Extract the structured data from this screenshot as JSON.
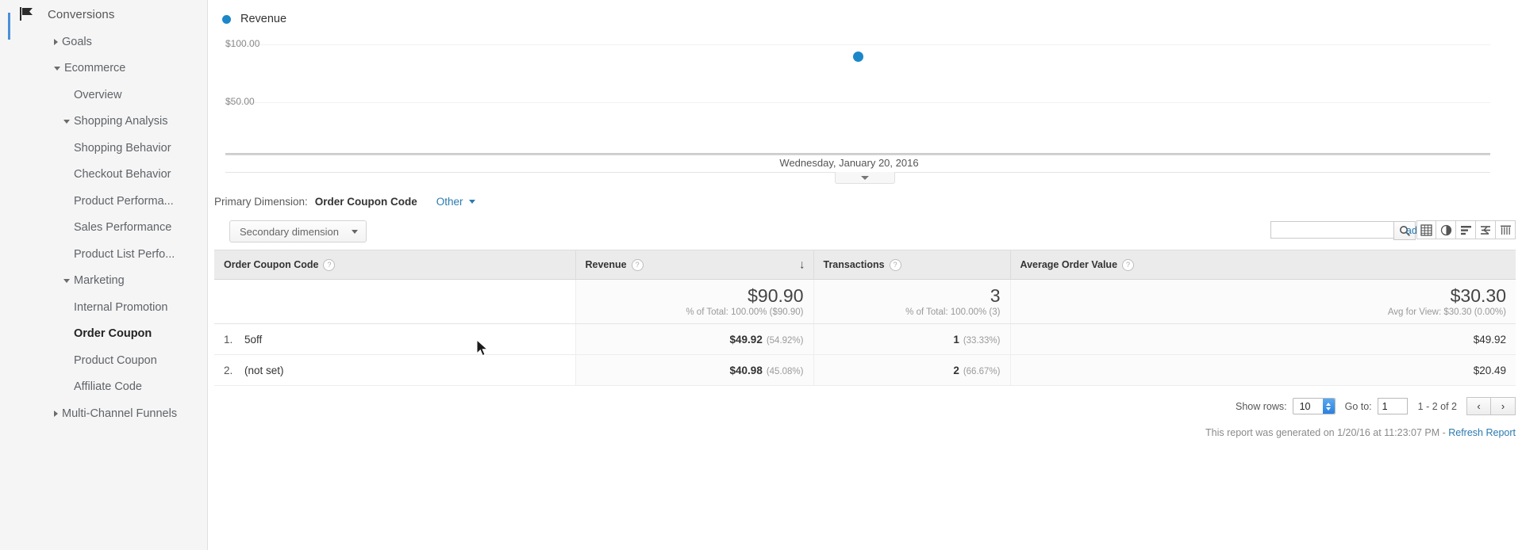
{
  "sidebar": {
    "section": {
      "label": "Conversions",
      "icon": "flag-icon"
    },
    "items": [
      {
        "label": "Goals",
        "level": 1,
        "caret": "right",
        "selected": false
      },
      {
        "label": "Ecommerce",
        "level": 1,
        "caret": "down",
        "selected": false
      },
      {
        "label": "Overview",
        "level": 2,
        "caret": "none",
        "selected": false
      },
      {
        "label": "Shopping Analysis",
        "level": 2,
        "caret": "down",
        "selected": false
      },
      {
        "label": "Shopping Behavior",
        "level": 3,
        "caret": "none",
        "selected": false
      },
      {
        "label": "Checkout Behavior",
        "level": 3,
        "caret": "none",
        "selected": false
      },
      {
        "label": "Product Performa...",
        "level": 2,
        "caret": "none",
        "selected": false
      },
      {
        "label": "Sales Performance",
        "level": 2,
        "caret": "none",
        "selected": false
      },
      {
        "label": "Product List Perfo...",
        "level": 2,
        "caret": "none",
        "selected": false
      },
      {
        "label": "Marketing",
        "level": 2,
        "caret": "down",
        "selected": false
      },
      {
        "label": "Internal Promotion",
        "level": 3,
        "caret": "none",
        "selected": false
      },
      {
        "label": "Order Coupon",
        "level": 3,
        "caret": "none",
        "selected": true
      },
      {
        "label": "Product Coupon",
        "level": 3,
        "caret": "none",
        "selected": false
      },
      {
        "label": "Affiliate Code",
        "level": 3,
        "caret": "none",
        "selected": false
      },
      {
        "label": "Multi-Channel Funnels",
        "level": 1,
        "caret": "right",
        "selected": false
      }
    ]
  },
  "chart_data": {
    "type": "scatter",
    "title": "",
    "legend": [
      {
        "name": "Revenue",
        "color": "#1b87c9"
      }
    ],
    "legend_position": "top-left",
    "x": [
      "Wednesday, January 20, 2016"
    ],
    "xlabel": "",
    "categories": [
      "Wednesday, January 20, 2016"
    ],
    "series": [
      {
        "name": "Revenue",
        "values": [
          90.9
        ]
      }
    ],
    "values": [
      90.9
    ],
    "ylabel": "",
    "ylim": [
      0,
      125
    ],
    "yticks": [
      50,
      100
    ],
    "ytick_labels": [
      "$50.00",
      "$100.00"
    ],
    "grid": true,
    "point_color": "#1b87c9",
    "axis_date_label": "Wednesday, January 20, 2016"
  },
  "chart": {
    "legend_label": "Revenue",
    "ytick_top": "$100.00",
    "ytick_mid": "$50.00",
    "date_label": "Wednesday, January 20, 2016",
    "collapse_icon": "chevron-down-icon"
  },
  "primary_dimension": {
    "label": "Primary Dimension:",
    "value": "Order Coupon Code",
    "other_label": "Other",
    "other_caret": "chevron-down-icon"
  },
  "toolbar": {
    "secondary_dimension_label": "Secondary dimension",
    "secondary_caret": "chevron-down-icon",
    "search_value": "",
    "search_placeholder": "",
    "search_icon": "search-icon",
    "advanced_label": "advanced",
    "view_buttons": [
      {
        "name": "table-view-icon",
        "title": "Data Table"
      },
      {
        "name": "pie-chart-view-icon",
        "title": "Pie Chart"
      },
      {
        "name": "bar-chart-view-icon",
        "title": "Performance"
      },
      {
        "name": "comparison-view-icon",
        "title": "Comparison"
      },
      {
        "name": "pivot-view-icon",
        "title": "Pivot"
      }
    ]
  },
  "table": {
    "headers": [
      {
        "label": "Order Coupon Code",
        "help": "?",
        "sorted": false
      },
      {
        "label": "Revenue",
        "help": "?",
        "sorted": true,
        "sort_dir": "desc",
        "sort_icon": "↓"
      },
      {
        "label": "Transactions",
        "help": "?",
        "sorted": false
      },
      {
        "label": "Average Order Value",
        "help": "?",
        "sorted": false
      }
    ],
    "summary": {
      "revenue_value": "$90.90",
      "revenue_sub": "% of Total: 100.00% ($90.90)",
      "transactions_value": "3",
      "transactions_sub": "% of Total: 100.00% (3)",
      "aov_value": "$30.30",
      "aov_sub": "Avg for View: $30.30 (0.00%)"
    },
    "rows": [
      {
        "index": "1.",
        "dimension": "5off",
        "revenue": "$49.92",
        "revenue_pct": "(54.92%)",
        "transactions": "1",
        "transactions_pct": "(33.33%)",
        "aov": "$49.92"
      },
      {
        "index": "2.",
        "dimension": "(not set)",
        "revenue": "$40.98",
        "revenue_pct": "(45.08%)",
        "transactions": "2",
        "transactions_pct": "(66.67%)",
        "aov": "$20.49"
      }
    ]
  },
  "pagination": {
    "show_rows_label": "Show rows:",
    "rows_value": "10",
    "goto_label": "Go to:",
    "goto_value": "1",
    "range_label": "1 - 2 of 2",
    "prev_icon": "chevron-left-icon",
    "next_icon": "chevron-right-icon",
    "prev_glyph": "‹",
    "next_glyph": "›"
  },
  "footer": {
    "generated_text": "This report was generated on 1/20/16 at 11:23:07 PM - ",
    "refresh_label": "Refresh Report"
  }
}
